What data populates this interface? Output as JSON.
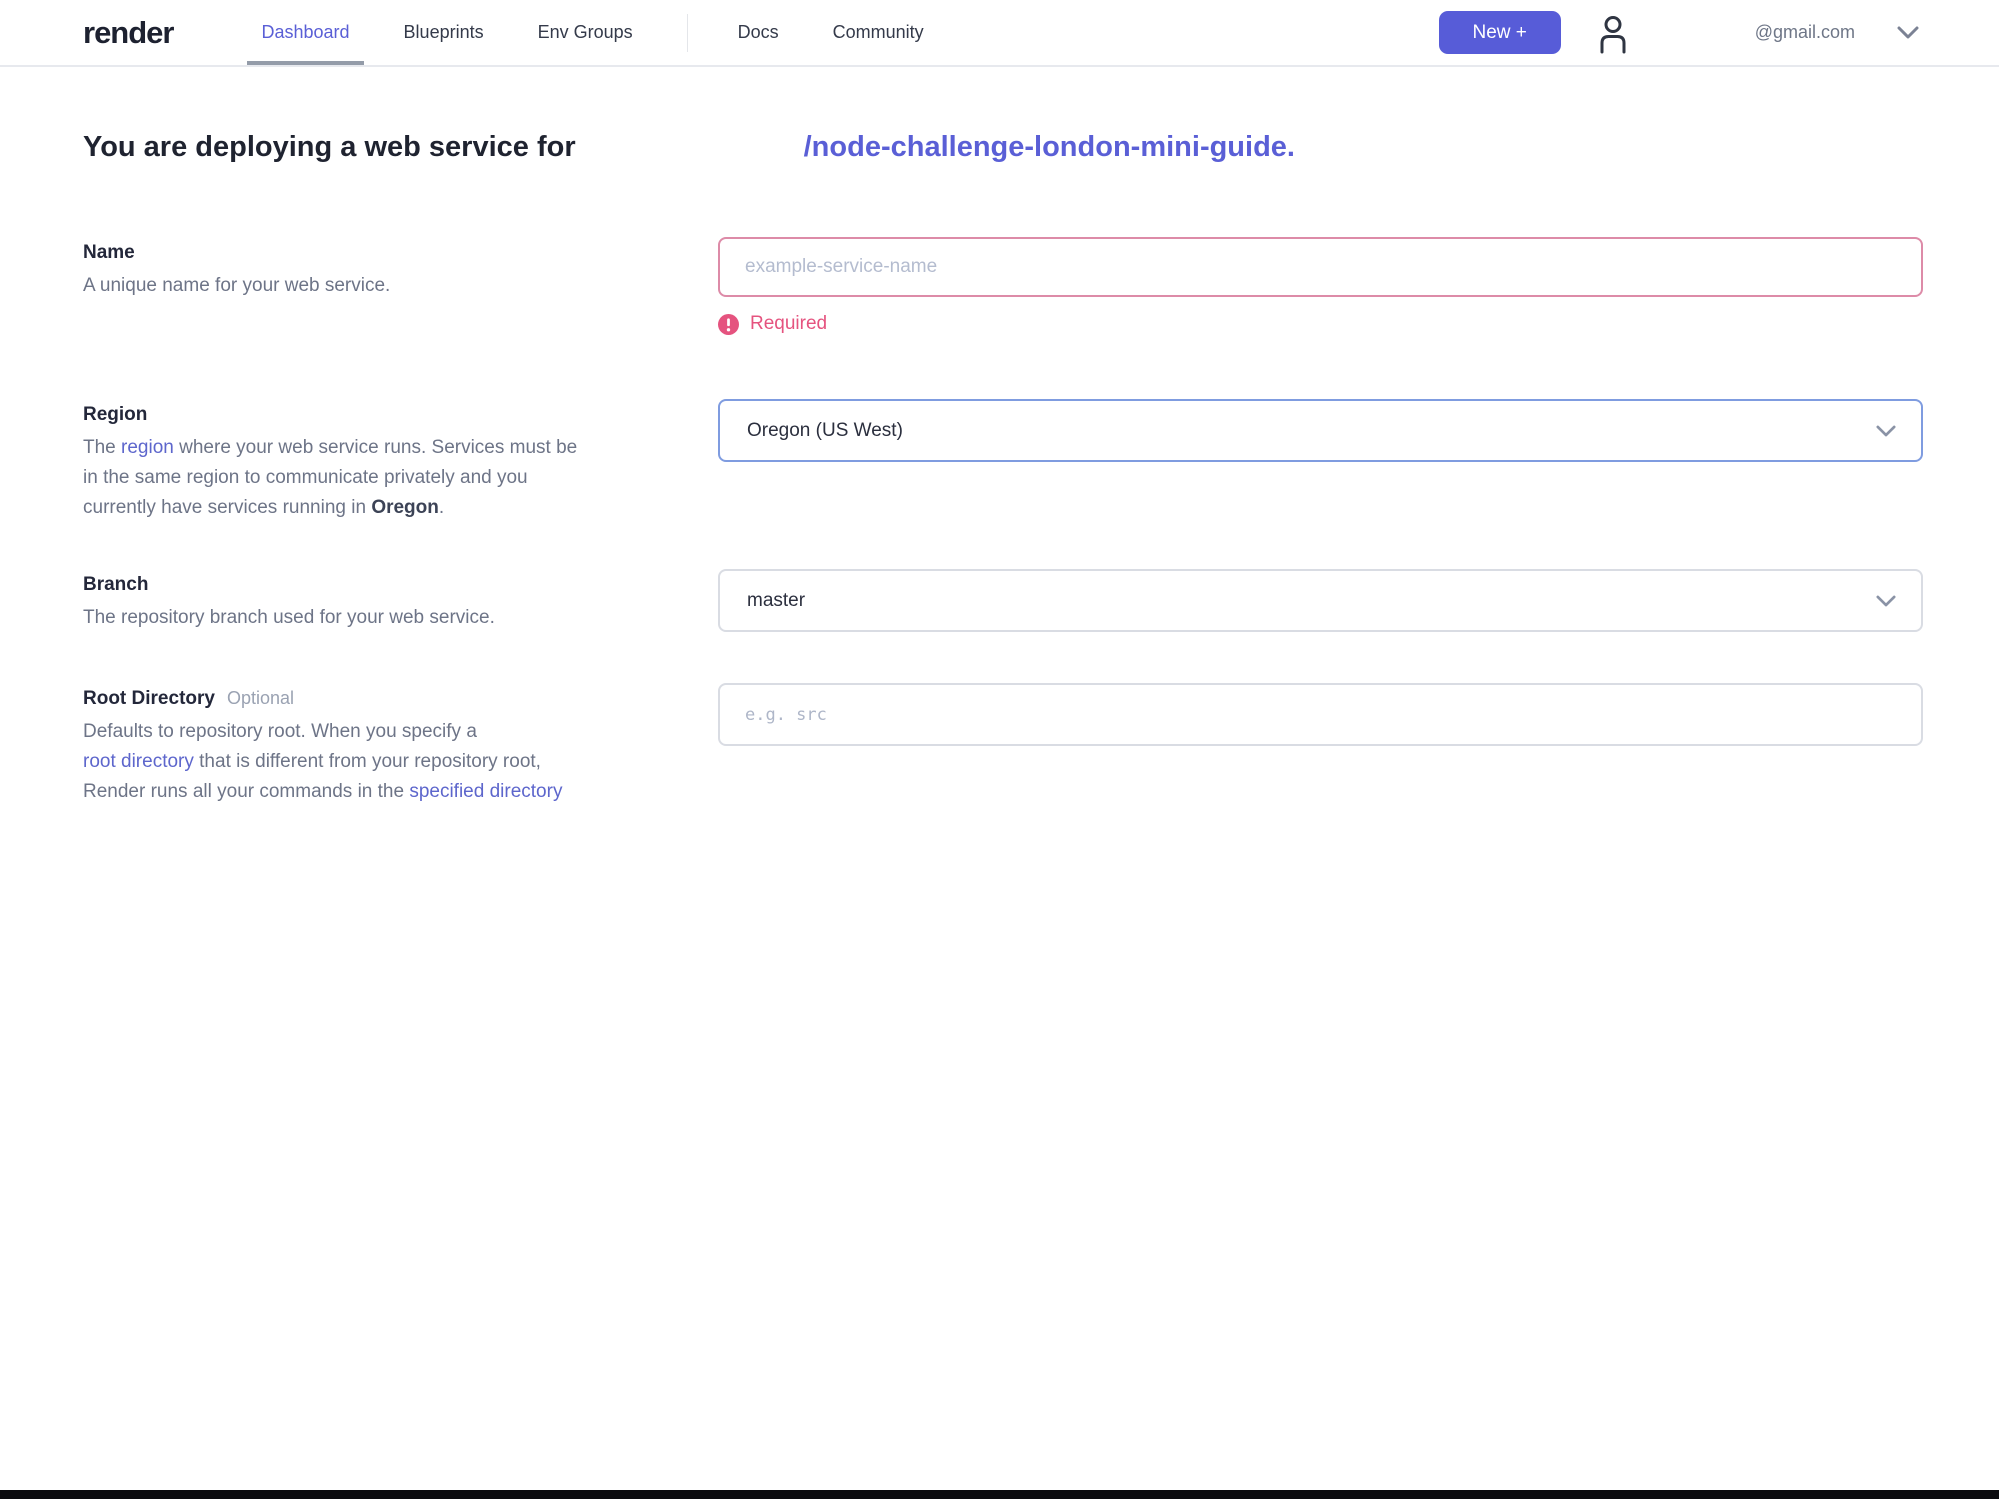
{
  "nav": {
    "logo": "render",
    "items": [
      {
        "label": "Dashboard",
        "active": true
      },
      {
        "label": "Blueprints",
        "active": false
      },
      {
        "label": "Env Groups",
        "active": false
      }
    ],
    "secondary": [
      {
        "label": "Docs"
      },
      {
        "label": "Community"
      }
    ],
    "new_button_label": "New +",
    "account": {
      "email": "@gmail.com"
    }
  },
  "heading": {
    "prefix": "You are deploying a web service for",
    "repo_link": "/node-challenge-london-mini-guide."
  },
  "form": {
    "name": {
      "label": "Name",
      "description": "A unique name for your web service.",
      "placeholder": "example-service-name",
      "error": "Required"
    },
    "region": {
      "label": "Region",
      "value": "Oregon (US West)",
      "description_lines": [
        [
          {
            "t": "The "
          },
          {
            "t": "region",
            "link": true
          },
          {
            "t": " where your web service runs. Services must be"
          }
        ],
        [
          {
            "t": "in the same region to communicate privately and you"
          }
        ],
        [
          {
            "t": "currently have services running in "
          },
          {
            "t": "Oregon",
            "bold": true
          },
          {
            "t": "."
          }
        ]
      ]
    },
    "branch": {
      "label": "Branch",
      "description": "The repository branch used for your web service.",
      "value": "master"
    },
    "root_directory": {
      "label": "Root Directory",
      "optional_tag": "Optional",
      "placeholder": "e.g. src",
      "description_lines": [
        [
          {
            "t": "Defaults to repository root. When you specify a"
          }
        ],
        [
          {
            "t": "root directory",
            "link": true
          },
          {
            "t": " that is different from your repository root,"
          }
        ],
        [
          {
            "t": "Render runs all your commands in the "
          },
          {
            "t": "specified directory",
            "link": true
          }
        ]
      ]
    }
  },
  "icons": {
    "user_profile": "person-outline",
    "chevron_down": "chevron-down",
    "error": "exclamation-circle"
  },
  "colors": {
    "accent": "#5a5fd6",
    "accent-btn": "#575cd8",
    "error": "#e5537f",
    "error-border": "#dd8ba8",
    "focus-border": "#7f9ce0",
    "link": "#5d66cc"
  }
}
